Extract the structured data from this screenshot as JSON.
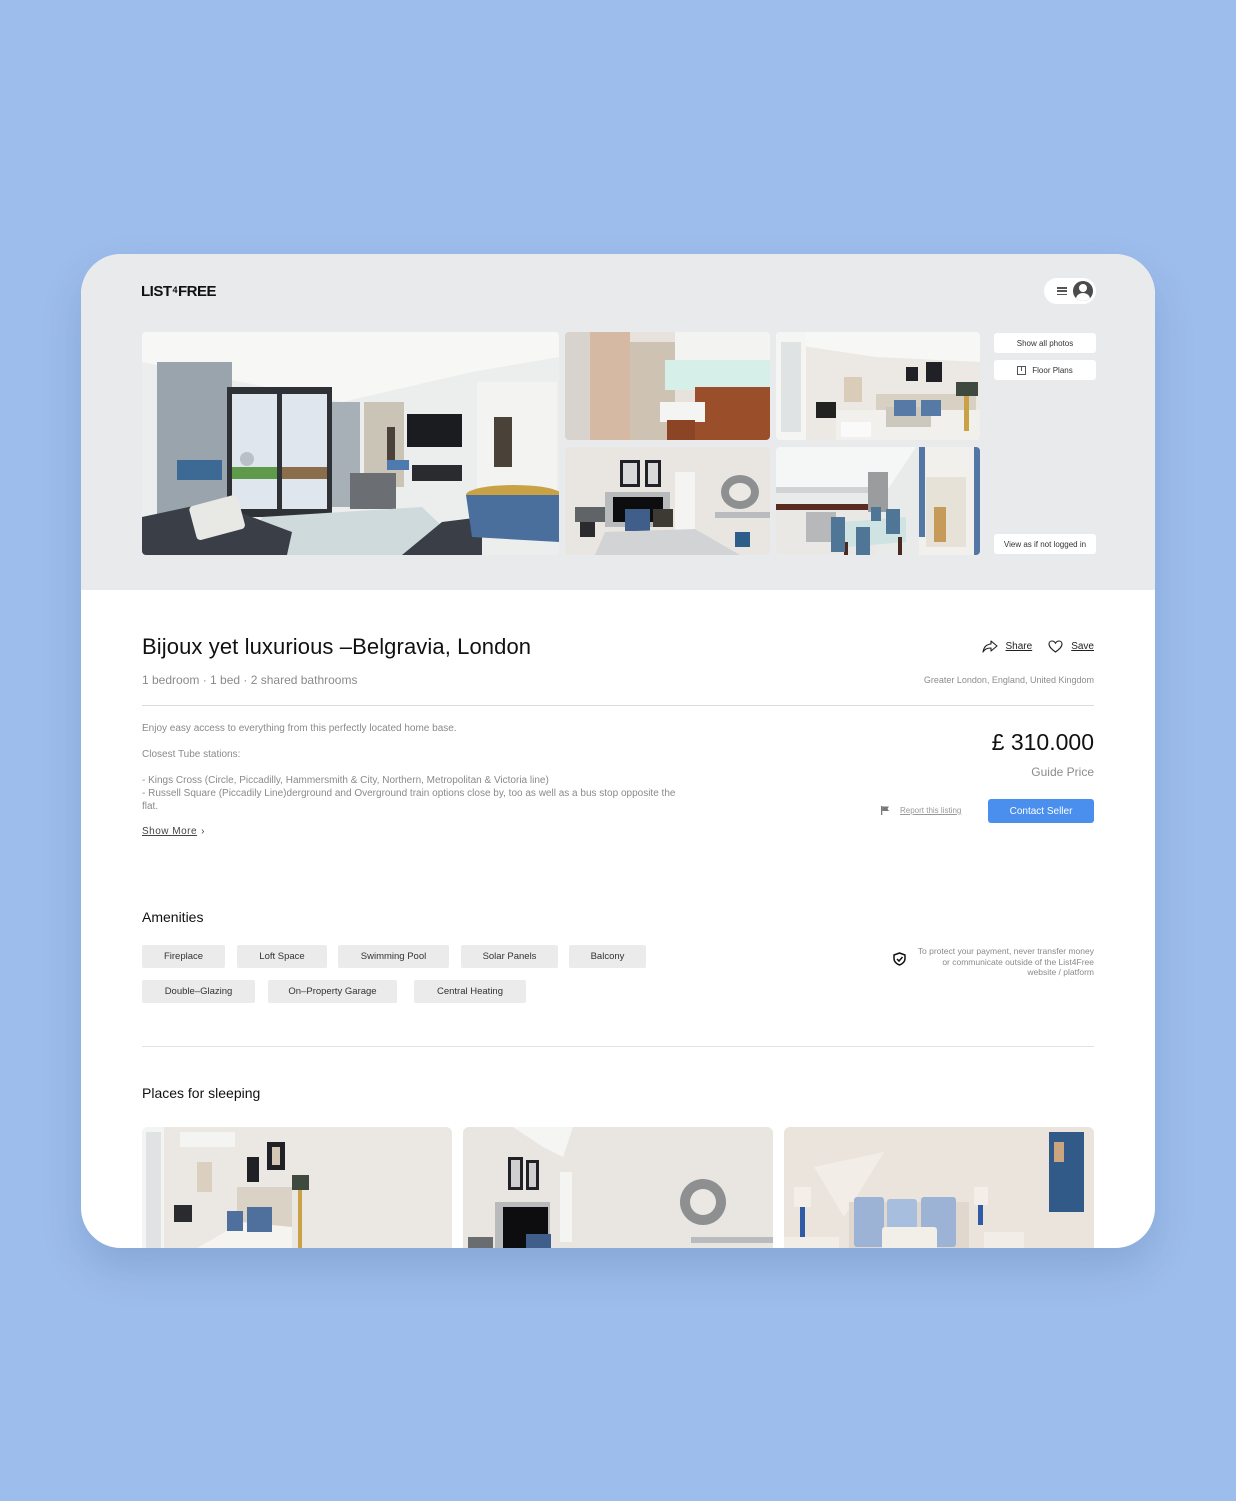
{
  "header": {
    "logo_left": "LIST",
    "logo_mid": "4",
    "logo_right": "FREE",
    "menu_icon": "hamburger-icon",
    "avatar_icon": "user-avatar-icon"
  },
  "gallery": {
    "photos": [
      {
        "alt": "Living room with garden view"
      },
      {
        "alt": "Bathroom with glass shower"
      },
      {
        "alt": "Bedroom with sash window"
      },
      {
        "alt": "Bedroom with round mirror"
      },
      {
        "alt": "Kitchen and dining area"
      }
    ],
    "show_all_label": "Show all photos",
    "floor_plans_label": "Floor Plans",
    "view_logged_out_label": "View as if not logged in"
  },
  "listing": {
    "title": "Bijoux yet luxurious –Belgravia, London",
    "subtitle": "1 bedroom · 1 bed · 2 shared bathrooms",
    "share_label": "Share",
    "save_label": "Save",
    "location": "Greater London, England, United Kingdom",
    "description": {
      "line1": "Enjoy easy access to everything from this perfectly located home base.",
      "line2": "Closest Tube stations:",
      "line3": "- Kings Cross (Circle, Piccadilly, Hammersmith & City, Northern, Metropolitan & Victoria line)",
      "line4": "- Russell Square (Piccadily Line)derground and Overground train options close by, too as well as a bus stop opposite the flat."
    },
    "show_more_label": "Show More",
    "price": "£ 310.000",
    "price_label": "Guide Price",
    "report_label": "Report this listing",
    "contact_label": "Contact Seller"
  },
  "amenities": {
    "title": "Amenities",
    "items": [
      "Fireplace",
      "Loft Space",
      "Swimming Pool",
      "Solar Panels",
      "Balcony",
      "Double–Glazing",
      "On–Property Garage",
      "Central Heating"
    ],
    "safety_notice": "To protect your payment, never transfer money or communicate outside of the List4Free website / platform"
  },
  "sleeping": {
    "title": "Places for sleeping",
    "cards": [
      {
        "alt": "Bedroom 1"
      },
      {
        "alt": "Bedroom 2"
      },
      {
        "alt": "Bedroom 3"
      }
    ]
  },
  "colors": {
    "background": "#9dbdec",
    "accent": "#4a8eee",
    "hero_bg": "#e9eaec"
  }
}
